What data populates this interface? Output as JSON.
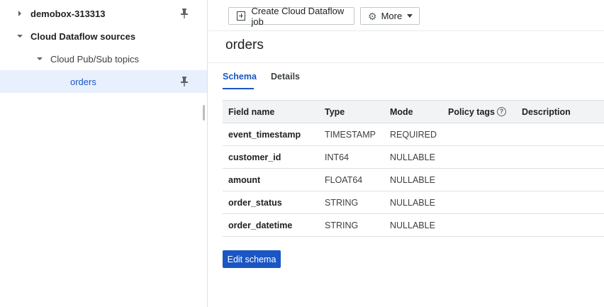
{
  "sidebar": {
    "items": [
      {
        "label": "demobox-313313"
      },
      {
        "label": "Cloud Dataflow sources"
      },
      {
        "label": "Cloud Pub/Sub topics"
      },
      {
        "label": "orders"
      }
    ]
  },
  "toolbar": {
    "create_label": "Create Cloud Dataflow job",
    "more_label": "More"
  },
  "page": {
    "title": "orders"
  },
  "tabs": [
    {
      "label": "Schema",
      "active": true
    },
    {
      "label": "Details",
      "active": false
    }
  ],
  "table": {
    "headers": [
      "Field name",
      "Type",
      "Mode",
      "Policy tags",
      "Description"
    ],
    "rows": [
      {
        "field": "event_timestamp",
        "type": "TIMESTAMP",
        "mode": "REQUIRED",
        "policy": "",
        "description": ""
      },
      {
        "field": "customer_id",
        "type": "INT64",
        "mode": "NULLABLE",
        "policy": "",
        "description": ""
      },
      {
        "field": "amount",
        "type": "FLOAT64",
        "mode": "NULLABLE",
        "policy": "",
        "description": ""
      },
      {
        "field": "order_status",
        "type": "STRING",
        "mode": "NULLABLE",
        "policy": "",
        "description": ""
      },
      {
        "field": "order_datetime",
        "type": "STRING",
        "mode": "NULLABLE",
        "policy": "",
        "description": ""
      }
    ]
  },
  "actions": {
    "edit_schema_label": "Edit schema"
  },
  "colors": {
    "accent": "#1a56c4",
    "selected_bg": "#e8f0fe",
    "header_bg": "#f1f3f4"
  },
  "icons": {
    "pin": "pin-icon",
    "add": "add-box-icon",
    "gear": "gear-icon",
    "help": "help-icon"
  }
}
